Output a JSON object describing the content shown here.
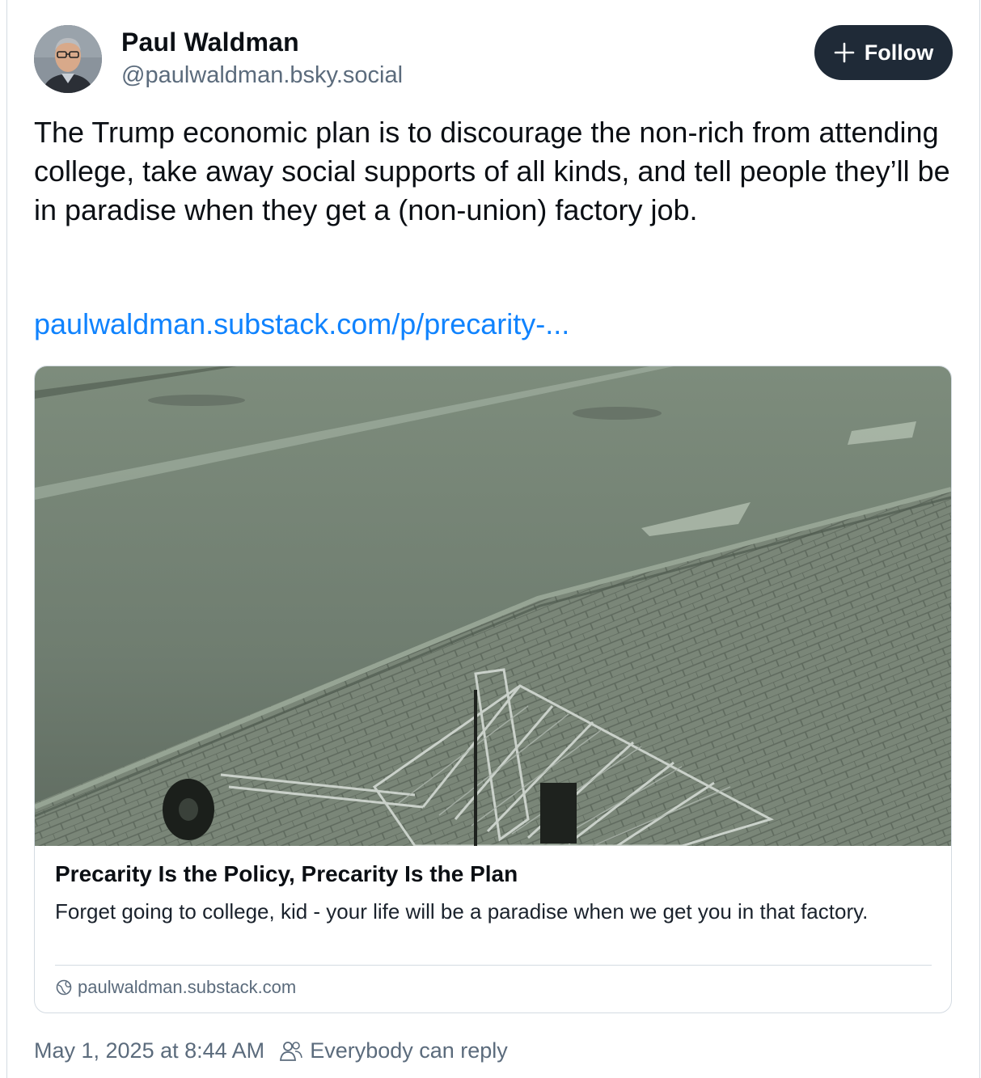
{
  "author": {
    "display_name": "Paul Waldman",
    "handle": "@paulwaldman.bsky.social",
    "avatar_icon": "person-portrait"
  },
  "follow_button": {
    "label": "Follow",
    "icon": "plus-icon"
  },
  "post": {
    "text": "The Trump economic plan is to discourage the non-rich from attending college, take away social supports of all kinds, and tell people they’ll be in paradise when they get a (non-union) factory job.",
    "link_text": "paulwaldman.substack.com/p/precarity-..."
  },
  "link_card": {
    "image_description_icon": "shopping-cart-photo",
    "title": "Precarity Is the Policy, Precarity Is the Plan",
    "description": "Forget going to college, kid - your life will be a paradise when we get you in that factory.",
    "domain": "paulwaldman.substack.com",
    "domain_icon": "globe-icon"
  },
  "footer": {
    "timestamp": "May 1, 2025 at 8:44 AM",
    "reply_setting": "Everybody can reply",
    "reply_icon": "people-icon"
  },
  "colors": {
    "link": "#1083fe",
    "follow_bg": "#1f2a37",
    "muted_text": "#5b6b7c",
    "border": "#d4dbe2"
  }
}
